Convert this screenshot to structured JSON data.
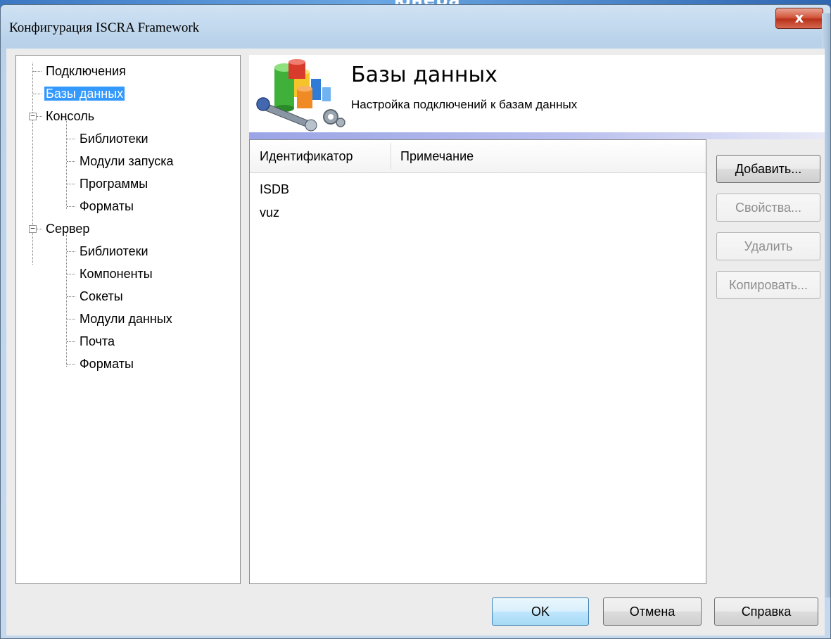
{
  "window": {
    "title": "Конфигурация ISCRA Framework",
    "close_glyph": "x"
  },
  "desktop_fragment_text": "юнера",
  "tree": {
    "items": [
      {
        "label": "Подключения",
        "level": 1,
        "selected": false
      },
      {
        "label": "Базы данных",
        "level": 1,
        "selected": true
      },
      {
        "label": "Консоль",
        "level": 1,
        "expander": "−"
      },
      {
        "label": "Библиотеки",
        "level": 2
      },
      {
        "label": "Модули запуска",
        "level": 2
      },
      {
        "label": "Программы",
        "level": 2
      },
      {
        "label": "Форматы",
        "level": 2
      },
      {
        "label": "Сервер",
        "level": 1,
        "expander": "−"
      },
      {
        "label": "Библиотеки",
        "level": 2
      },
      {
        "label": "Компоненты",
        "level": 2
      },
      {
        "label": "Сокеты",
        "level": 2
      },
      {
        "label": "Модули данных",
        "level": 2
      },
      {
        "label": "Почта",
        "level": 2
      },
      {
        "label": "Форматы",
        "level": 2
      }
    ]
  },
  "header": {
    "title": "Базы данных",
    "subtitle": "Настройка подключений к базам данных",
    "icon": "database-tools-icon"
  },
  "list": {
    "columns": [
      "Идентификатор",
      "Примечание"
    ],
    "rows": [
      {
        "id": "ISDB",
        "note": ""
      },
      {
        "id": "vuz",
        "note": ""
      }
    ]
  },
  "side_buttons": {
    "add": "Добавить...",
    "properties": "Свойства...",
    "delete": "Удалить",
    "copy": "Копировать..."
  },
  "footer_buttons": {
    "ok": "OK",
    "cancel": "Отмена",
    "help": "Справка"
  },
  "colors": {
    "selection": "#3399ff",
    "close_button": "#c8452b",
    "header_band": "#9ba4e6"
  }
}
